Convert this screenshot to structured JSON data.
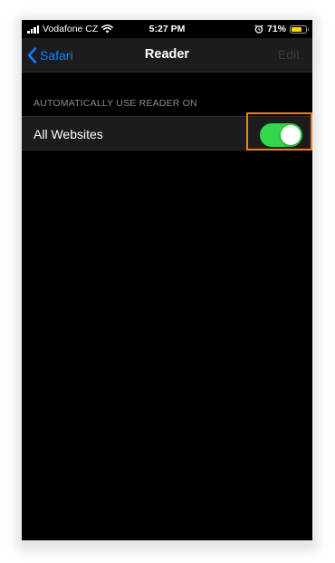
{
  "status_bar": {
    "carrier": "Vodafone CZ",
    "time": "5:27 PM",
    "battery": "71%",
    "battery_level": 0.71,
    "icons": [
      "signal-icon",
      "wifi-icon",
      "alarm-icon",
      "battery-icon"
    ]
  },
  "nav": {
    "back_label": "Safari",
    "title": "Reader",
    "edit_label": "Edit"
  },
  "section": {
    "header": "AUTOMATICALLY USE READER ON"
  },
  "rows": [
    {
      "label": "All Websites",
      "toggle_on": true
    }
  ],
  "colors": {
    "accent": "#0a84ff",
    "toggle_on": "#32d74b",
    "highlight": "#f97f15",
    "battery_fill": "#ffd60a"
  }
}
